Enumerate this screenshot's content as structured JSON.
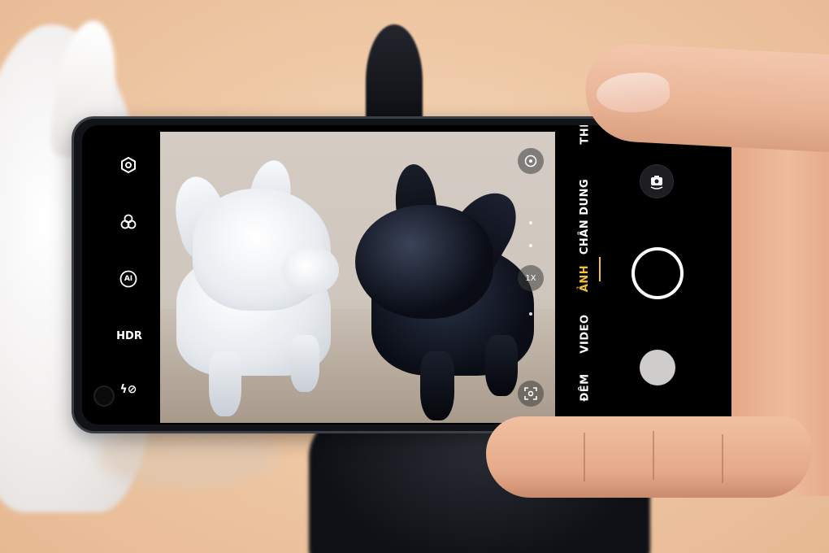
{
  "camera": {
    "left_controls": [
      {
        "name": "settings-icon",
        "label": ""
      },
      {
        "name": "filter-icon",
        "label": ""
      },
      {
        "name": "ai-icon",
        "label": "AI"
      },
      {
        "name": "hdr-toggle",
        "label": "HDR"
      },
      {
        "name": "flash-off-icon",
        "label": "ϟ⊘"
      }
    ],
    "zoom_label": "1X",
    "modes": [
      {
        "label": "THỂ",
        "active": false
      },
      {
        "label": "CHÂN DUNG",
        "active": false
      },
      {
        "label": "ẢNH",
        "active": true
      },
      {
        "label": "VIDEO",
        "active": false
      },
      {
        "label": "ĐÊM",
        "active": false
      }
    ],
    "accent_color": "#f2c230",
    "nav_buttons": [
      "◁",
      "□",
      "⦀"
    ]
  }
}
